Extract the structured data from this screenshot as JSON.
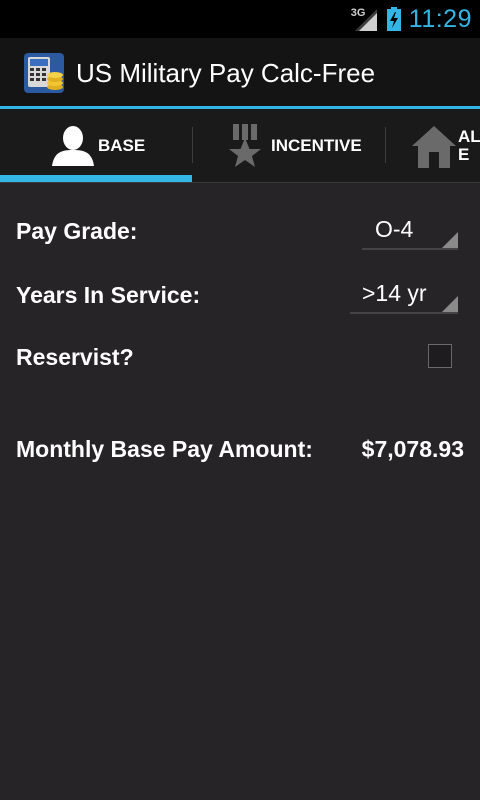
{
  "status": {
    "network": "3G",
    "time": "11:29"
  },
  "app": {
    "title": "US Military Pay Calc-Free"
  },
  "tabs": [
    {
      "label": "BASE",
      "icon": "person-icon"
    },
    {
      "label": "INCENTIVE",
      "icon": "medal-icon"
    },
    {
      "label": "AL\nE",
      "label_line1": "AL",
      "label_line2": "E",
      "icon": "house-icon"
    }
  ],
  "form": {
    "pay_grade_label": "Pay Grade:",
    "pay_grade_value": "O-4",
    "years_label": "Years In Service:",
    "years_value": ">14 yr",
    "reservist_label": "Reservist?",
    "reservist_checked": false
  },
  "result": {
    "label": "Monthly Base Pay Amount:",
    "value": "$7,078.93"
  },
  "colors": {
    "accent": "#33b5e5",
    "background": "#272428"
  }
}
